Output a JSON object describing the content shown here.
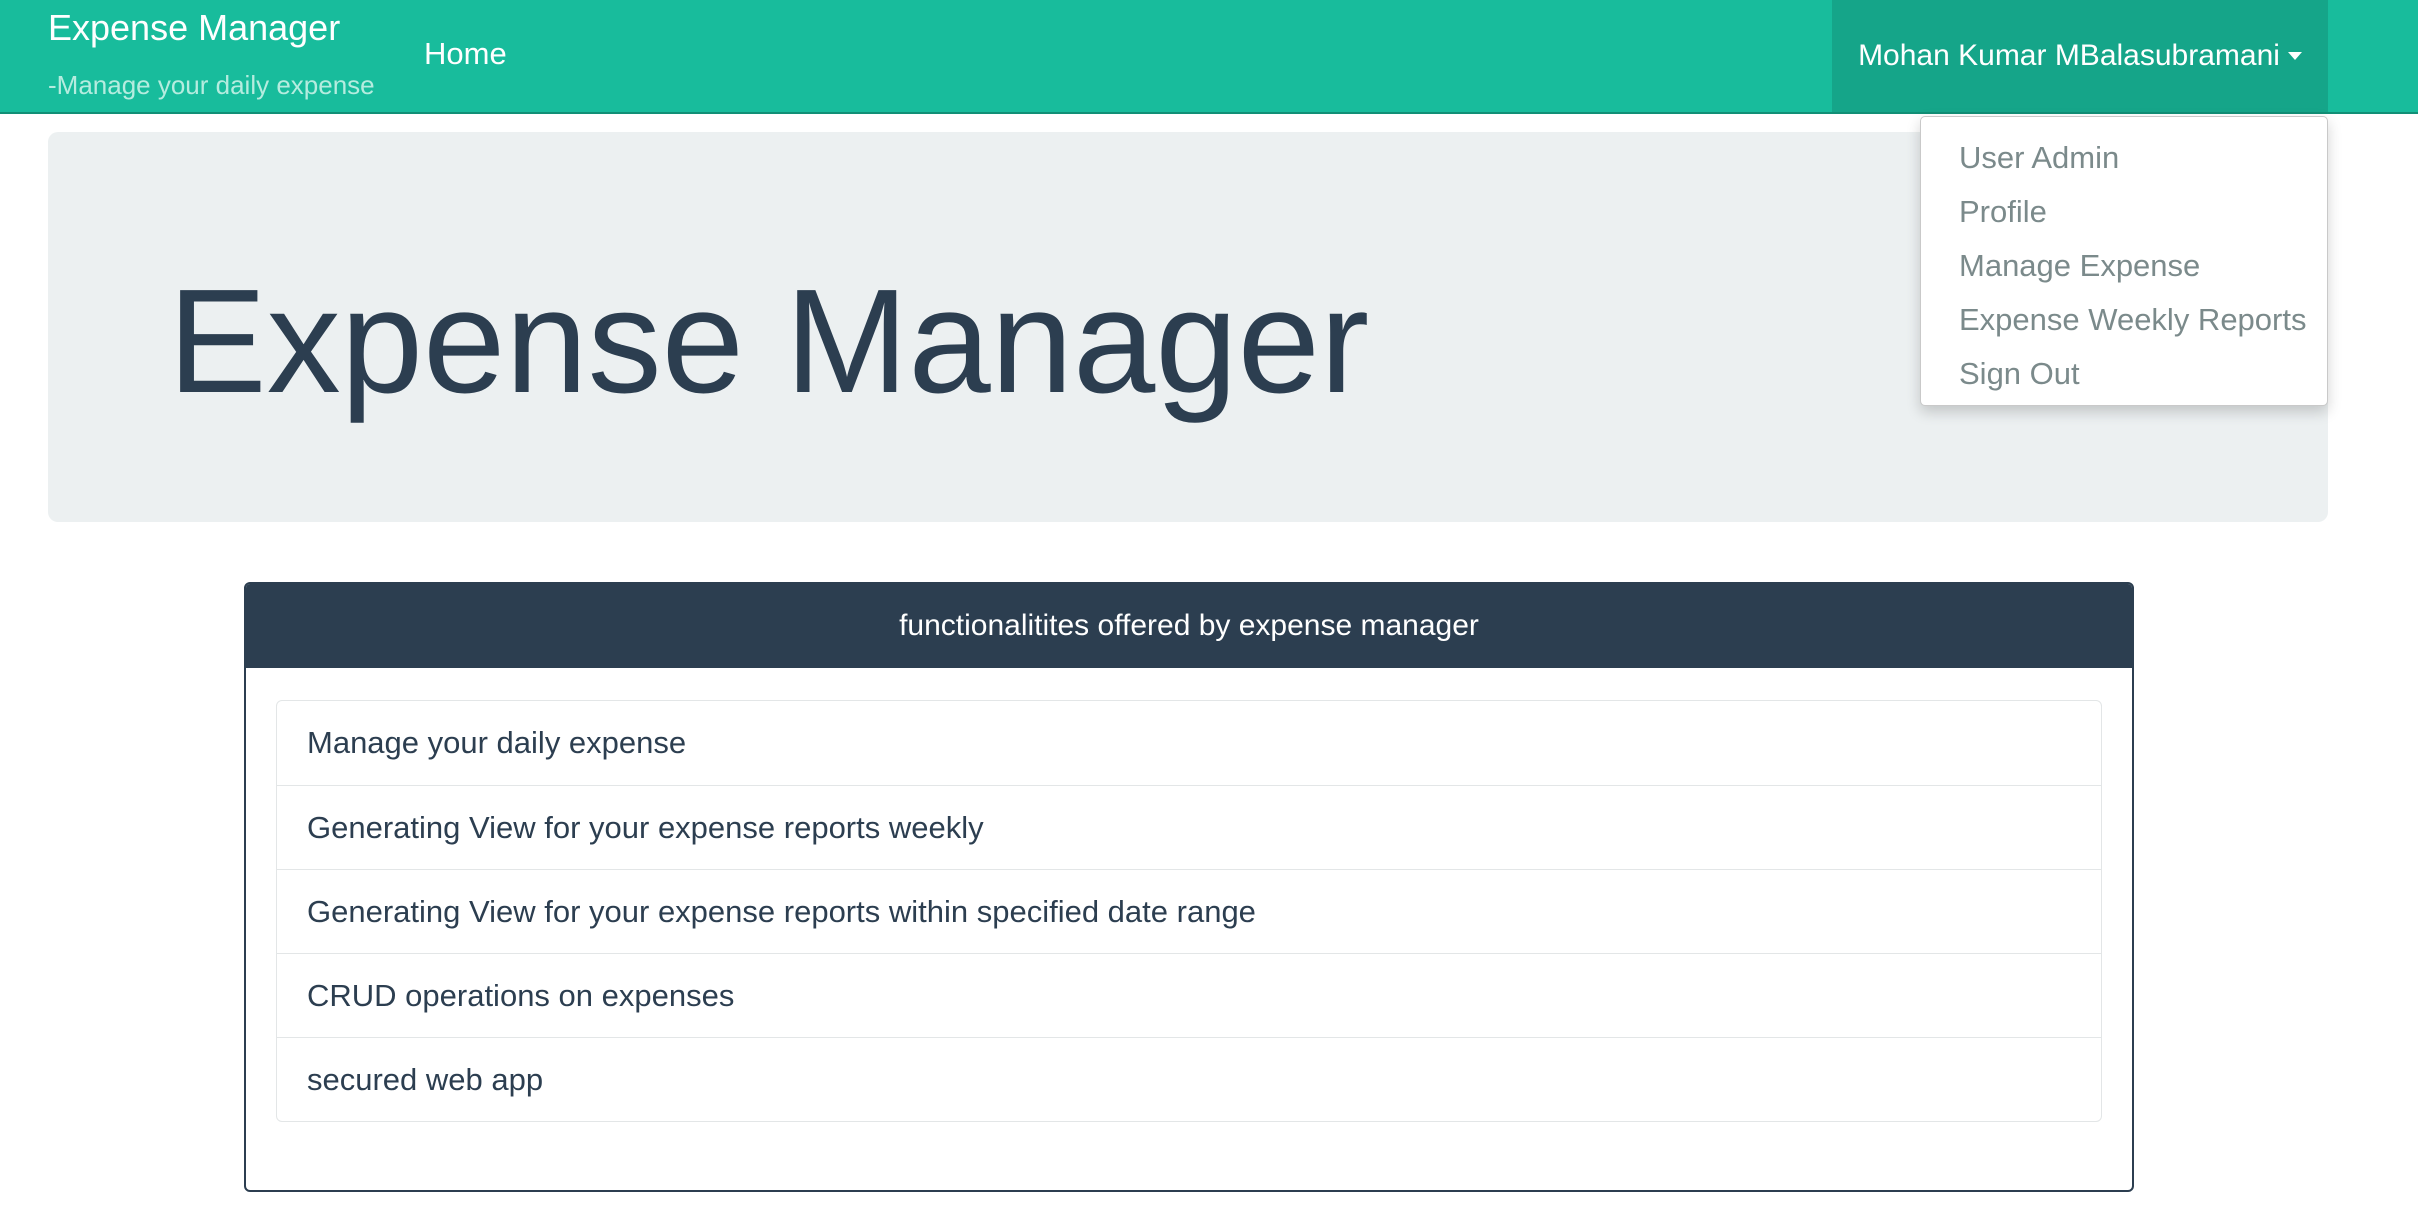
{
  "navbar": {
    "brand_title": "Expense Manager",
    "brand_subtitle": "-Manage your daily expense",
    "home_label": "Home",
    "user_name": "Mohan Kumar MBalasubramani",
    "background_color": "#18bc9c"
  },
  "dropdown": {
    "items": [
      {
        "label": "User Admin"
      },
      {
        "label": "Profile"
      },
      {
        "label": "Manage Expense"
      },
      {
        "label": "Expense Weekly Reports"
      },
      {
        "label": "Sign Out"
      }
    ]
  },
  "jumbotron": {
    "title": "Expense Manager"
  },
  "panel": {
    "heading": "functionalitites offered by expense manager",
    "items": [
      {
        "text": "Manage your daily expense"
      },
      {
        "text": "Generating View for your expense reports weekly"
      },
      {
        "text": "Generating View for your expense reports within specified date range"
      },
      {
        "text": "CRUD operations on expenses"
      },
      {
        "text": "secured web app"
      }
    ]
  }
}
